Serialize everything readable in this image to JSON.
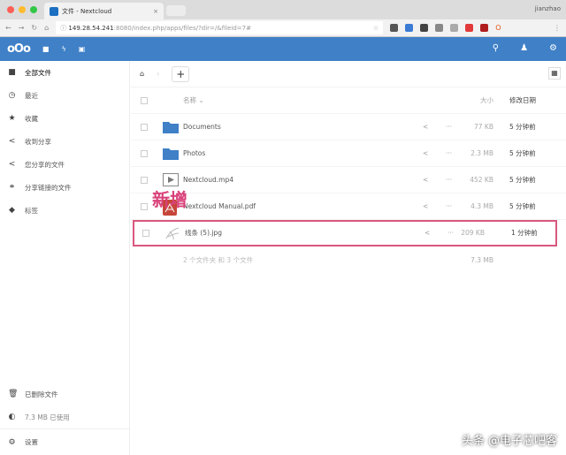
{
  "browser": {
    "tab_title": "文件 - Nextcloud",
    "user": "jianzhao",
    "url_host": "149.28.54.241",
    "url_rest": ":8080/index.php/apps/files/?dir=/&fileid=7#"
  },
  "nav": {
    "logo": "oOo"
  },
  "sidebar": {
    "items": [
      {
        "icon": "folder-icon",
        "glyph": "■",
        "label": "全部文件"
      },
      {
        "icon": "clock-icon",
        "glyph": "◷",
        "label": "最近"
      },
      {
        "icon": "star-icon",
        "glyph": "★",
        "label": "收藏"
      },
      {
        "icon": "share-icon",
        "glyph": "<",
        "label": "收到分享"
      },
      {
        "icon": "share-icon",
        "glyph": "<",
        "label": "您分享的文件"
      },
      {
        "icon": "link-icon",
        "glyph": "⚭",
        "label": "分享链接的文件"
      },
      {
        "icon": "tag-icon",
        "glyph": "◆",
        "label": "标签"
      }
    ],
    "deleted": "已删除文件",
    "quota": "7.3 MB 已使用",
    "settings": "设置"
  },
  "table": {
    "col_name": "名称",
    "col_size": "大小",
    "col_date": "修改日期",
    "rows": [
      {
        "name": "Documents",
        "type": "folder",
        "size": "77 KB",
        "date": "5 分钟前"
      },
      {
        "name": "Photos",
        "type": "folder",
        "size": "2.3 MB",
        "date": "5 分钟前"
      },
      {
        "name": "Nextcloud.mp4",
        "type": "video",
        "size": "452 KB",
        "date": "5 分钟前"
      },
      {
        "name": "Nextcloud Manual.pdf",
        "type": "pdf",
        "size": "4.3 MB",
        "date": "5 分钟前"
      },
      {
        "name": "线条 (5).jpg",
        "type": "image",
        "size": "209 KB",
        "date": "1 分钟前"
      }
    ],
    "summary": "2 个文件夹 和 3 个文件",
    "summary_size": "7.3 MB"
  },
  "annotation": "新增",
  "watermark": "头条 @电子芯吧客"
}
